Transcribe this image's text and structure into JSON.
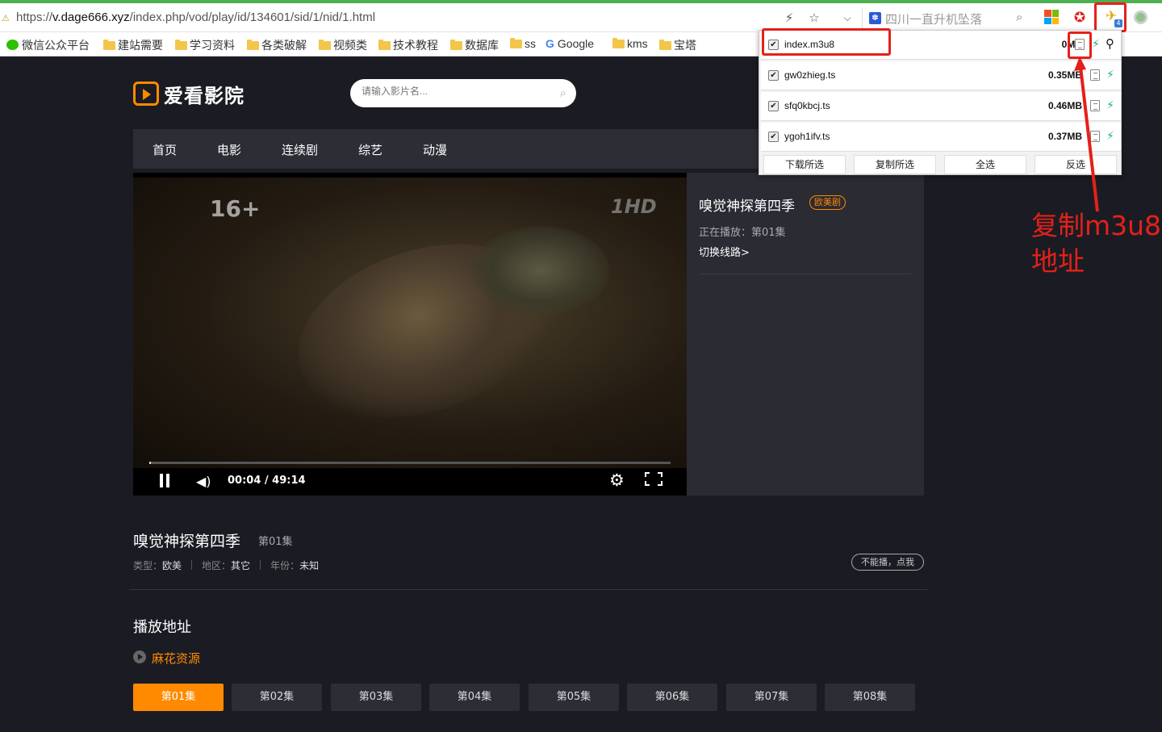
{
  "browser": {
    "url_prefix": "https://",
    "url_host": "v.dage666.xyz",
    "url_path": "/index.php/vod/play/id/134601/sid/1/nid/1.html",
    "search_placeholder": "四川一直升机坠落",
    "bookmarks": [
      "微信公众平台",
      "建站需要",
      "学习资料",
      "各类破解",
      "视频类",
      "技术教程",
      "数据库",
      "ss",
      "Google",
      "kms",
      "宝塔"
    ]
  },
  "site": {
    "logo": "爱看影院",
    "search_placeholder": "请输入影片名...",
    "nav": [
      "首页",
      "电影",
      "连续剧",
      "综艺",
      "动漫"
    ]
  },
  "player": {
    "rating": "16+",
    "channel": "1HD",
    "time": "00:04 / 49:14",
    "progress": 0.0014
  },
  "sidebar": {
    "title": "嗅觉神探第四季",
    "badge": "欧美剧",
    "now_playing": "正在播放：第01集",
    "switch_line": "切换线路>"
  },
  "info": {
    "title": "嗅觉神探第四季",
    "episode": "第01集",
    "type_label": "类型：",
    "type_value": "欧美",
    "region_label": "地区：",
    "region_value": "其它",
    "year_label": "年份：",
    "year_value": "未知",
    "report": "不能播，点我"
  },
  "playlist": {
    "heading": "播放地址",
    "source": "麻花资源",
    "episodes": [
      "第01集",
      "第02集",
      "第03集",
      "第04集",
      "第05集",
      "第06集",
      "第07集",
      "第08集"
    ],
    "active_index": 0
  },
  "popup": {
    "items": [
      {
        "name": "index.m3u8",
        "size": "0MB"
      },
      {
        "name": "gw0zhieg.ts",
        "size": "0.35MB"
      },
      {
        "name": "sfq0kbcj.ts",
        "size": "0.46MB"
      },
      {
        "name": "ygoh1ifv.ts",
        "size": "0.37MB"
      }
    ],
    "buttons": [
      "下载所选",
      "复制所选",
      "全选",
      "反选"
    ]
  },
  "annotation": {
    "line1": "复制m3u8",
    "line2": "地址",
    "color": "#e5201a"
  },
  "colors": {
    "accent": "#ff8a00",
    "background": "#1b1c23",
    "nav": "#2c2d35"
  }
}
